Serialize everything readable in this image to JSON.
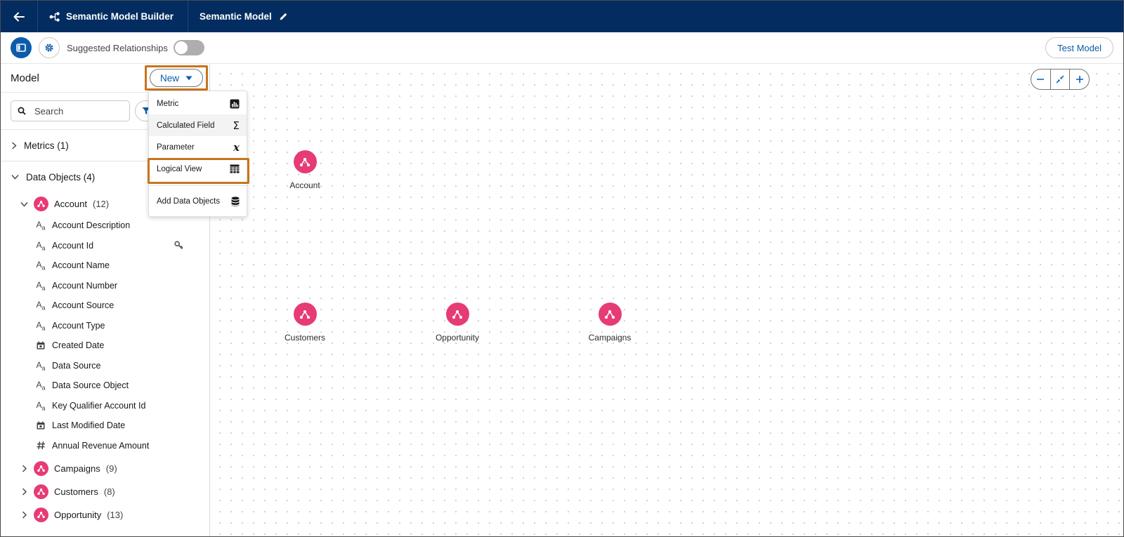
{
  "header": {
    "app_name": "Semantic Model Builder",
    "model_name": "Semantic Model"
  },
  "toolbar": {
    "suggested_label": "Suggested Relationships",
    "suggested_on": false,
    "test_button": "Test Model"
  },
  "sidebar": {
    "title": "Model",
    "new_button": "New",
    "search_placeholder": "Search",
    "sections": {
      "metrics": "Metrics (1)",
      "data_objects": "Data Objects (4)"
    },
    "objects": [
      {
        "name": "Account",
        "count": "(12)",
        "expanded": true
      },
      {
        "name": "Campaigns",
        "count": "(9)",
        "expanded": false
      },
      {
        "name": "Customers",
        "count": "(8)",
        "expanded": false
      },
      {
        "name": "Opportunity",
        "count": "(13)",
        "expanded": false
      }
    ],
    "account_fields": [
      {
        "label": "Account Description",
        "type": "text-icon"
      },
      {
        "label": "Account Id",
        "type": "text-icon",
        "key": "key-icon"
      },
      {
        "label": "Account Name",
        "type": "text-icon"
      },
      {
        "label": "Account Number",
        "type": "text-icon"
      },
      {
        "label": "Account Source",
        "type": "text-icon"
      },
      {
        "label": "Account Type",
        "type": "text-icon"
      },
      {
        "label": "Created Date",
        "type": "calendar-icon"
      },
      {
        "label": "Data Source",
        "type": "text-icon"
      },
      {
        "label": "Data Source Object",
        "type": "text-icon"
      },
      {
        "label": "Key Qualifier Account Id",
        "type": "text-icon"
      },
      {
        "label": "Last Modified Date",
        "type": "calendar-icon"
      },
      {
        "label": "Annual Revenue Amount",
        "type": "number-icon"
      }
    ]
  },
  "menu": {
    "items": [
      {
        "label": "Metric",
        "icon": "bar-chart-icon"
      },
      {
        "label": "Calculated Field",
        "icon": "sigma-icon"
      },
      {
        "label": "Parameter",
        "icon": "variable-x-icon"
      },
      {
        "label": "Logical View",
        "icon": "table-icon"
      },
      {
        "label": "Add Data Objects",
        "icon": "database-icon"
      }
    ]
  },
  "canvas": {
    "nodes": [
      {
        "label": "Account"
      },
      {
        "label": "Customers"
      },
      {
        "label": "Opportunity"
      },
      {
        "label": "Campaigns"
      }
    ]
  },
  "colors": {
    "header_bg": "#032d60",
    "brand_blue": "#0b5cab",
    "object_pink": "#e73b76",
    "highlight_orange": "#c8741e"
  }
}
